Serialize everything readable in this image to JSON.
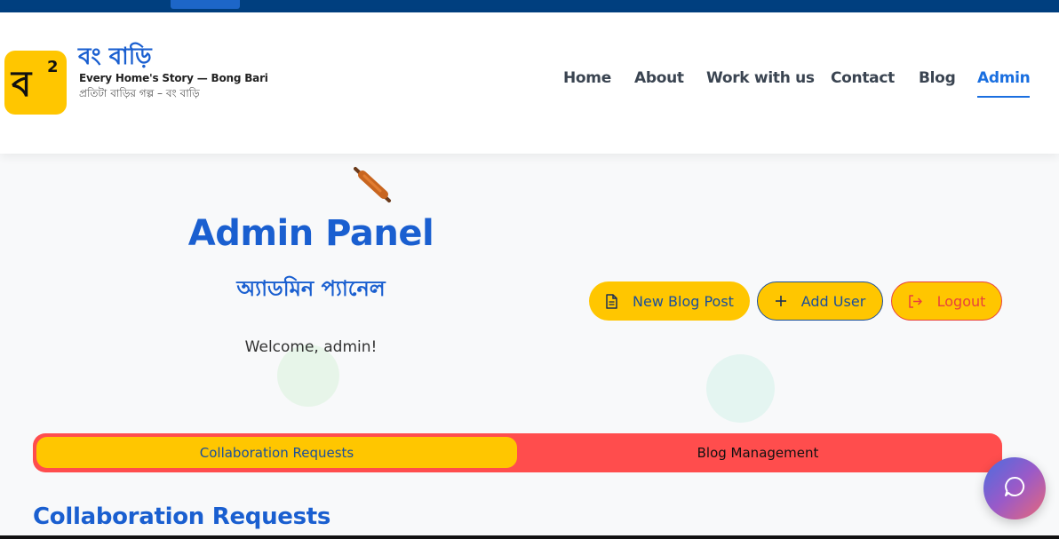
{
  "brand": {
    "logo_glyph": "ব",
    "logo_sup": "2",
    "title": "বং বাড়ি",
    "tagline_en": "Every Home's Story — Bong Bari",
    "tagline_bn": "প্রতিটা বাড়ির গল্প – বং বাড়ি"
  },
  "nav": {
    "items": [
      {
        "label": "Home"
      },
      {
        "label": "About"
      },
      {
        "label": "Work with us"
      },
      {
        "label": "Contact"
      },
      {
        "label": "Blog"
      },
      {
        "label": "Admin",
        "active": true
      }
    ]
  },
  "panel": {
    "title": "Admin Panel",
    "title_bn": "অ্যাডমিন প্যানেল",
    "welcome": "Welcome, admin!"
  },
  "actions": {
    "new_blog_post": "New Blog Post",
    "add_user": "Add User",
    "logout": "Logout"
  },
  "tabs": {
    "collaboration": "Collaboration Requests",
    "blog_management": "Blog Management",
    "active": "collaboration"
  },
  "section": {
    "title": "Collaboration Requests"
  },
  "colors": {
    "primary": "#1a5fd0",
    "accent_yellow": "#ffc600",
    "accent_red": "#ff4d4d",
    "topbar": "#003f7f"
  },
  "icons": {
    "new_blog_post": "document-icon",
    "add_user": "plus-icon",
    "logout": "logout-icon",
    "chat": "chat-bubble-icon",
    "decoration": "rolling-pin-icon"
  }
}
